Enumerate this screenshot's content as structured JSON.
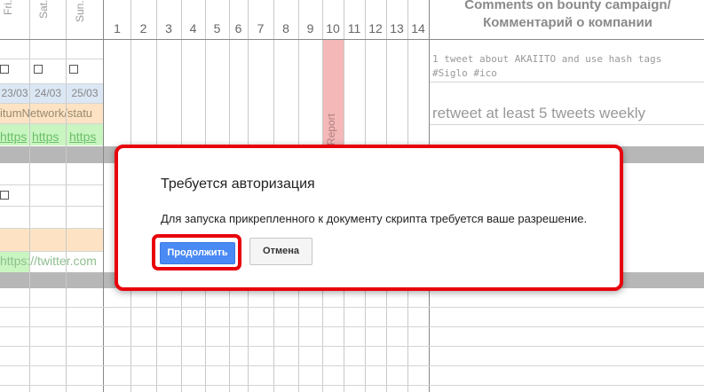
{
  "sheet": {
    "day_headers": [
      "Fri.",
      "Sat.",
      "Sun."
    ],
    "number_headers": [
      "1",
      "2",
      "3",
      "4",
      "5",
      "6",
      "7",
      "8",
      "9",
      "10",
      "11",
      "12",
      "13",
      "14"
    ],
    "comments_header": "Comments on bounty campaign/Комментарий о компании",
    "dates": [
      "23/03",
      "24/03",
      "25/03"
    ],
    "network_text": "itumNetwork/statu",
    "link_labels": [
      "https",
      "https",
      "https"
    ],
    "twitter_link": "https://twitter.com",
    "report_label": "Report",
    "comment_1": "1 tweet about AKAIITO and use hash tags #Siglo #ico",
    "comment_2": "retweet at least 5 tweets weekly"
  },
  "dialog": {
    "title": "Требуется авторизация",
    "message": "Для запуска прикрепленного к документу скрипта требуется ваше разрешение.",
    "continue_label": "Продолжить",
    "cancel_label": "Отмена"
  },
  "colors": {
    "highlight_outline": "#e8000b",
    "primary_button": "#4a8af4",
    "report_column": "#f4b8b8",
    "date_row": "#dbe7f4",
    "orange_row": "#fde3c4",
    "green_row": "#c9f5c0",
    "separator_band": "#b7b7b7"
  }
}
